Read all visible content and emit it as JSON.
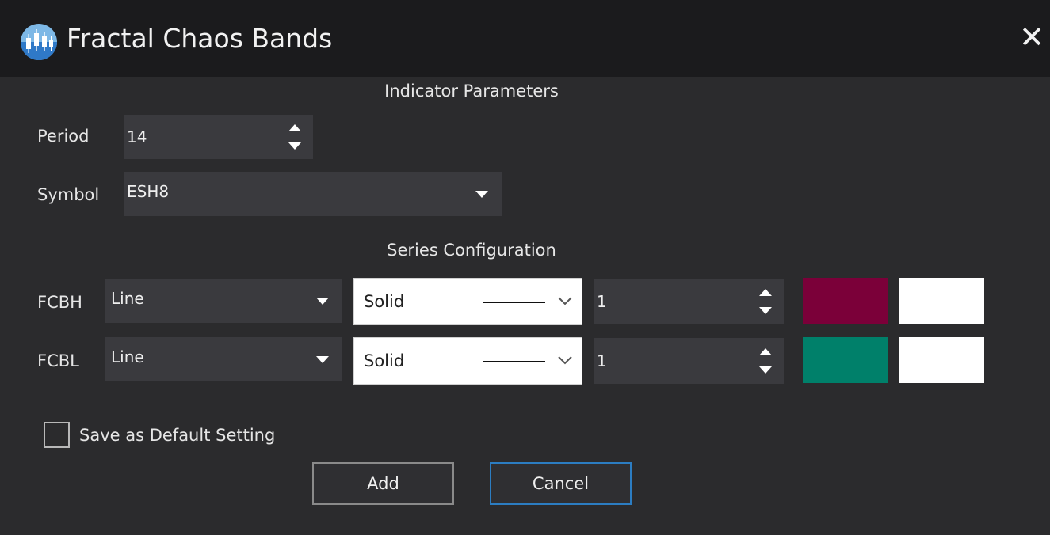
{
  "window": {
    "title": "Fractal Chaos Bands"
  },
  "icons": {
    "app": "candlestick-chart-icon",
    "close": "close-icon"
  },
  "close_symbol": "✕",
  "sections": {
    "indicator_parameters": "Indicator Parameters",
    "series_configuration": "Series Configuration"
  },
  "parameters": {
    "period": {
      "label": "Period",
      "value": "14"
    },
    "symbol": {
      "label": "Symbol",
      "value": "ESH8"
    }
  },
  "series": [
    {
      "name": "FCBH",
      "type": "Line",
      "line_style": "Solid",
      "width": "1",
      "color": "#7b0039",
      "secondary_color": "#ffffff"
    },
    {
      "name": "FCBL",
      "type": "Line",
      "line_style": "Solid",
      "width": "1",
      "color": "#00806a",
      "secondary_color": "#ffffff"
    }
  ],
  "save_default": {
    "label": "Save as Default Setting",
    "checked": false
  },
  "buttons": {
    "add": "Add",
    "cancel": "Cancel"
  },
  "colors": {
    "accent": "#2c7dc2",
    "background": "#2b2b2d",
    "titlebar": "#1b1b1d",
    "field": "#3a3a3e"
  }
}
